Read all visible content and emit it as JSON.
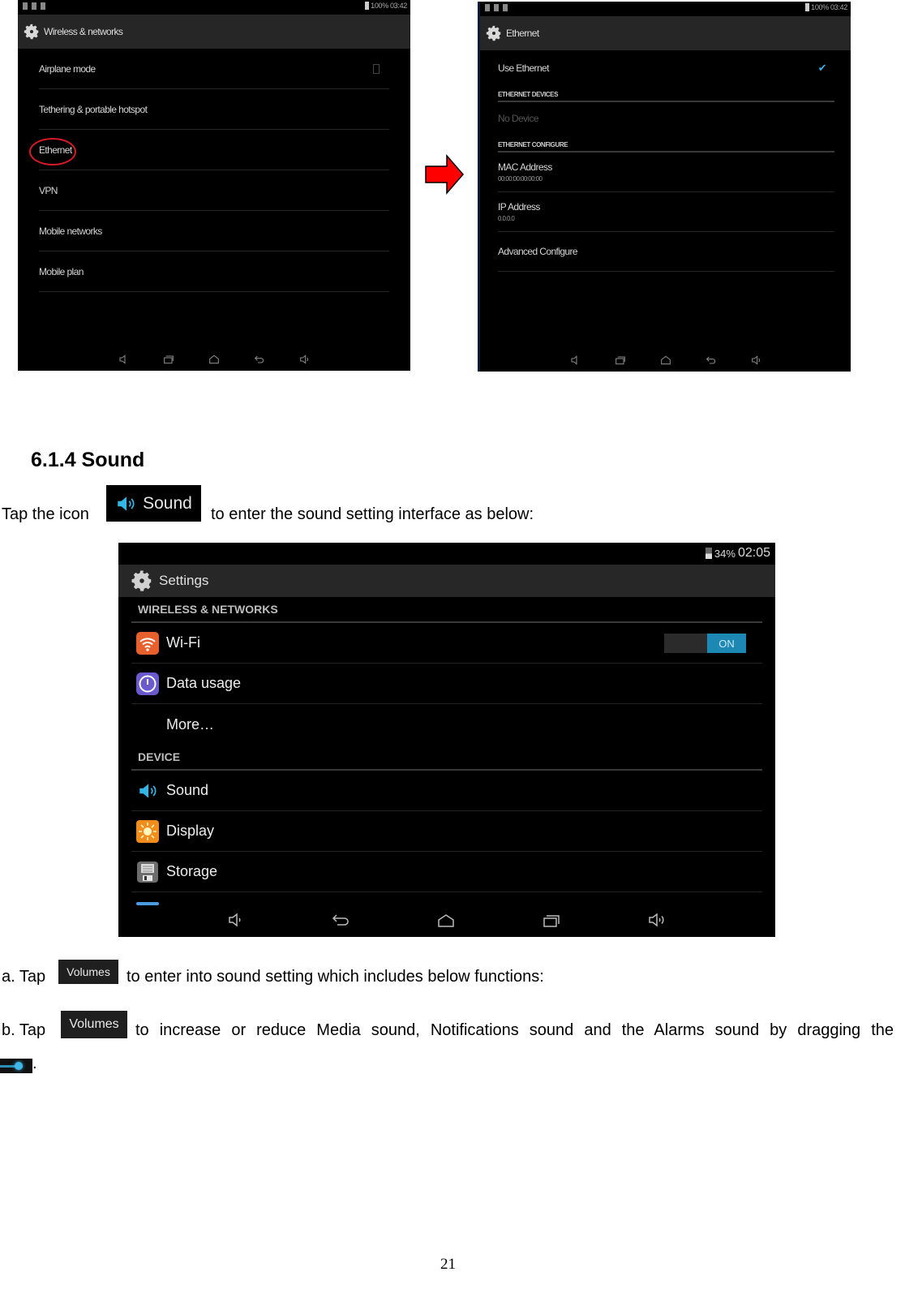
{
  "screenshot_wireless": {
    "status_bar": {
      "battery": "100%",
      "time": "03:42"
    },
    "title": "Wireless & networks",
    "items": [
      {
        "label": "Airplane mode",
        "has_checkbox": true
      },
      {
        "label": "Tethering & portable hotspot"
      },
      {
        "label": "Ethernet",
        "highlighted": true
      },
      {
        "label": "VPN"
      },
      {
        "label": "Mobile networks"
      },
      {
        "label": "Mobile plan"
      }
    ],
    "nav_icons": [
      "volume-down-icon",
      "recents-icon",
      "home-icon",
      "back-icon",
      "volume-up-icon"
    ]
  },
  "arrow": {
    "color": "#ff0000"
  },
  "screenshot_ethernet": {
    "status_bar": {
      "battery": "100%",
      "time": "03:42"
    },
    "title": "Ethernet",
    "use_ethernet": {
      "label": "Use Ethernet",
      "checked": true
    },
    "devices_header": "ETHERNET DEVICES",
    "no_device": "No Device",
    "configure_header": "ETHERNET CONFIGURE",
    "mac": {
      "label": "MAC Address",
      "value": "00:00:00:00:00:00"
    },
    "ip": {
      "label": "IP Address",
      "value": "0.0.0.0"
    },
    "advanced": "Advanced Configure"
  },
  "section": {
    "heading": "6.1.4 Sound",
    "intro_before": "Tap the icon",
    "intro_icon_label": "Sound",
    "intro_after": "to enter the sound setting interface as below:"
  },
  "settings_screenshot": {
    "status_bar": {
      "battery": "34%",
      "time": "02:05"
    },
    "title": "Settings",
    "categories": [
      {
        "label": "WIRELESS & NETWORKS",
        "items": [
          {
            "label": "Wi-Fi",
            "icon": "wifi-icon",
            "icon_color": "#e8612c",
            "toggle": "ON"
          },
          {
            "label": "Data usage",
            "icon": "data-usage-icon",
            "icon_color": "#6a5acd"
          },
          {
            "label": "More…",
            "icon": ""
          }
        ]
      },
      {
        "label": "DEVICE",
        "items": [
          {
            "label": "Sound",
            "icon": "speaker-icon",
            "icon_color": "#33b5e5"
          },
          {
            "label": "Display",
            "icon": "brightness-icon",
            "icon_color": "#f28c1c"
          },
          {
            "label": "Storage",
            "icon": "storage-icon",
            "icon_color": "#777777"
          }
        ]
      }
    ],
    "accent": "#1e88b4"
  },
  "step_a": {
    "prefix": "a. Tap",
    "button": "Volumes",
    "suffix": "to enter into sound setting which includes below functions:"
  },
  "step_b": {
    "prefix": "b. Tap",
    "button": "Volumes",
    "suffix": "to increase or reduce Media sound, Notifications sound and the Alarms sound by dragging the",
    "end": "."
  },
  "page_number": "21"
}
